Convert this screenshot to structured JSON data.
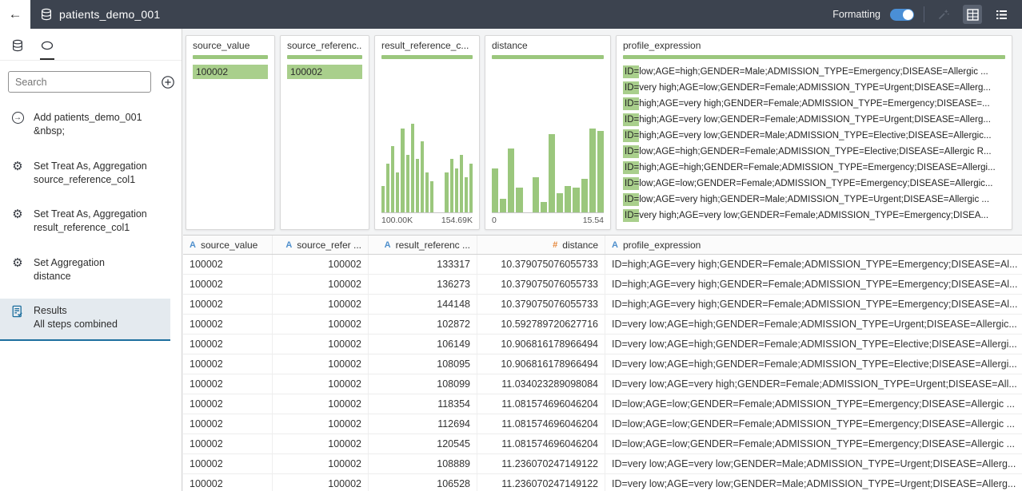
{
  "topbar": {
    "title": "patients_demo_001",
    "formatting_label": "Formatting",
    "toggle_on": true,
    "accent_color": "#4a8fd6",
    "icons": [
      "arrow-left-icon",
      "database-icon",
      "wand-icon",
      "table-view-icon",
      "list-view-icon"
    ]
  },
  "sidebar": {
    "search_placeholder": "Search",
    "tabs": [
      {
        "icon": "database-icon",
        "active": false
      },
      {
        "icon": "steps-icon",
        "active": true
      }
    ],
    "steps": [
      {
        "icon": "add-step-icon",
        "line1": "Add patients_demo_001",
        "line2": "&nbsp;",
        "selected": false
      },
      {
        "icon": "gear-icon",
        "line1": "Set Treat As, Aggregation",
        "line2": "source_reference_col1",
        "selected": false
      },
      {
        "icon": "gear-icon",
        "line1": "Set Treat As, Aggregation",
        "line2": "result_reference_col1",
        "selected": false
      },
      {
        "icon": "gear-icon",
        "line1": "Set Aggregation",
        "line2": "distance",
        "selected": false
      },
      {
        "icon": "results-icon",
        "line1": "Results",
        "line2": "All steps combined",
        "selected": true
      }
    ]
  },
  "cards": [
    {
      "field": "source_value",
      "type": "single",
      "value": "100002"
    },
    {
      "field": "source_referenc...",
      "type": "single",
      "value": "100002"
    },
    {
      "field": "result_reference_c...",
      "type": "histogram",
      "min_label": "100.00K",
      "max_label": "154.69K",
      "bars": [
        30,
        55,
        75,
        45,
        95,
        65,
        100,
        60,
        80,
        45,
        35,
        0,
        0,
        45,
        60,
        50,
        65,
        40,
        55
      ]
    },
    {
      "field": "distance",
      "type": "histogram",
      "min_label": "0",
      "max_label": "15.54",
      "bars": [
        50,
        15,
        72,
        28,
        0,
        40,
        12,
        88,
        22,
        30,
        28,
        38,
        95,
        92
      ]
    },
    {
      "field": "profile_expression",
      "type": "list",
      "values": [
        "ID=low;AGE=high;GENDER=Male;ADMISSION_TYPE=Emergency;DISEASE=Allergic ...",
        "ID=very high;AGE=low;GENDER=Female;ADMISSION_TYPE=Urgent;DISEASE=Allerg...",
        "ID=high;AGE=very high;GENDER=Female;ADMISSION_TYPE=Emergency;DISEASE=...",
        "ID=high;AGE=very low;GENDER=Female;ADMISSION_TYPE=Urgent;DISEASE=Allerg...",
        "ID=high;AGE=very low;GENDER=Male;ADMISSION_TYPE=Elective;DISEASE=Allergic...",
        "ID=low;AGE=high;GENDER=Female;ADMISSION_TYPE=Elective;DISEASE=Allergic R...",
        "ID=high;AGE=high;GENDER=Female;ADMISSION_TYPE=Emergency;DISEASE=Allergi...",
        "ID=low;AGE=low;GENDER=Female;ADMISSION_TYPE=Emergency;DISEASE=Allergic...",
        "ID=low;AGE=very high;GENDER=Male;ADMISSION_TYPE=Urgent;DISEASE=Allergic ...",
        "ID=very high;AGE=very low;GENDER=Female;ADMISSION_TYPE=Emergency;DISEA..."
      ]
    }
  ],
  "table": {
    "columns": [
      {
        "label": "source_value",
        "icon": "A",
        "type": "attribute",
        "align": "left"
      },
      {
        "label": "source_refer ...",
        "icon": "A",
        "type": "attribute",
        "align": "right"
      },
      {
        "label": "result_referenc ...",
        "icon": "A",
        "type": "attribute",
        "align": "right"
      },
      {
        "label": "distance",
        "icon": "#",
        "type": "measure",
        "align": "right"
      },
      {
        "label": "profile_expression",
        "icon": "A",
        "type": "attribute",
        "align": "left"
      }
    ],
    "rows": [
      [
        "100002",
        "100002",
        "133317",
        "10.379075076055733",
        "ID=high;AGE=very high;GENDER=Female;ADMISSION_TYPE=Emergency;DISEASE=Al..."
      ],
      [
        "100002",
        "100002",
        "136273",
        "10.379075076055733",
        "ID=high;AGE=very high;GENDER=Female;ADMISSION_TYPE=Emergency;DISEASE=Al..."
      ],
      [
        "100002",
        "100002",
        "144148",
        "10.379075076055733",
        "ID=high;AGE=very high;GENDER=Female;ADMISSION_TYPE=Emergency;DISEASE=Al..."
      ],
      [
        "100002",
        "100002",
        "102872",
        "10.592789720627716",
        "ID=very low;AGE=high;GENDER=Female;ADMISSION_TYPE=Urgent;DISEASE=Allergic..."
      ],
      [
        "100002",
        "100002",
        "106149",
        "10.906816178966494",
        "ID=very low;AGE=high;GENDER=Female;ADMISSION_TYPE=Elective;DISEASE=Allergi..."
      ],
      [
        "100002",
        "100002",
        "108095",
        "10.906816178966494",
        "ID=very low;AGE=high;GENDER=Female;ADMISSION_TYPE=Elective;DISEASE=Allergi..."
      ],
      [
        "100002",
        "100002",
        "108099",
        "11.034023289098084",
        "ID=very low;AGE=very high;GENDER=Female;ADMISSION_TYPE=Urgent;DISEASE=All..."
      ],
      [
        "100002",
        "100002",
        "118354",
        "11.081574696046204",
        "ID=low;AGE=low;GENDER=Female;ADMISSION_TYPE=Emergency;DISEASE=Allergic ..."
      ],
      [
        "100002",
        "100002",
        "112694",
        "11.081574696046204",
        "ID=low;AGE=low;GENDER=Female;ADMISSION_TYPE=Emergency;DISEASE=Allergic ..."
      ],
      [
        "100002",
        "100002",
        "120545",
        "11.081574696046204",
        "ID=low;AGE=low;GENDER=Female;ADMISSION_TYPE=Emergency;DISEASE=Allergic ..."
      ],
      [
        "100002",
        "100002",
        "108889",
        "11.236070247149122",
        "ID=very low;AGE=very low;GENDER=Male;ADMISSION_TYPE=Urgent;DISEASE=Allerg..."
      ],
      [
        "100002",
        "100002",
        "106528",
        "11.236070247149122",
        "ID=very low;AGE=very low;GENDER=Male;ADMISSION_TYPE=Urgent;DISEASE=Allerg..."
      ]
    ]
  }
}
